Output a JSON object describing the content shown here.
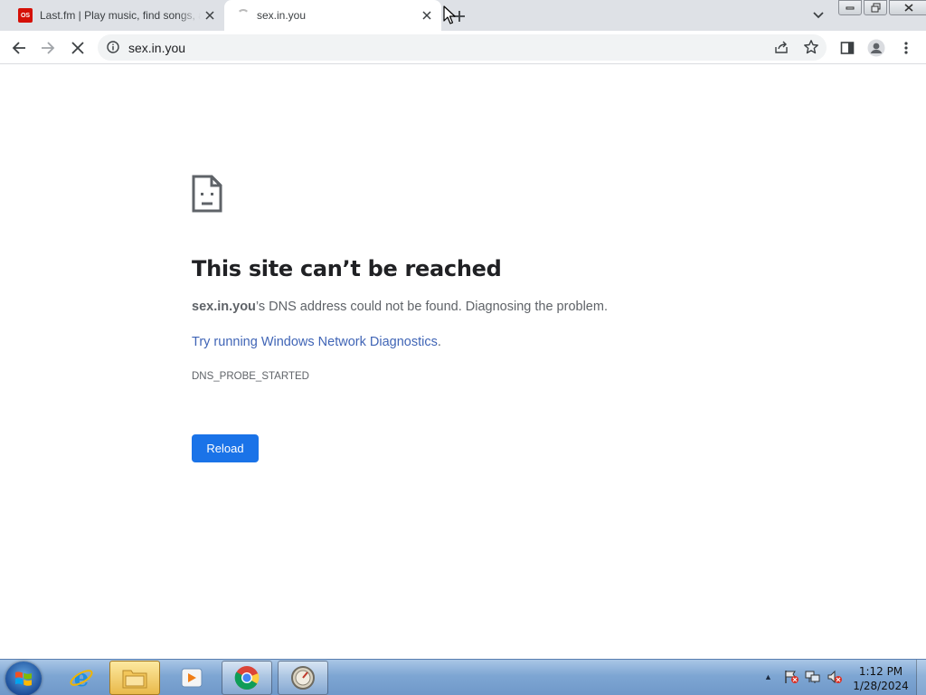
{
  "browser": {
    "tabs": [
      {
        "title": "Last.fm | Play music, find songs, and discover artists",
        "favicon": "lastfm-icon",
        "favicon_text": "OS",
        "active": false
      },
      {
        "title": "sex.in.you",
        "favicon": "loading-spinner",
        "active": true
      }
    ],
    "address_bar": {
      "url": "sex.in.you"
    }
  },
  "error_page": {
    "title": "This site can’t be reached",
    "host": "sex.in.you",
    "description_suffix": "’s DNS address could not be found. Diagnosing the problem.",
    "link_text": "Try running Windows Network Diagnostics",
    "link_suffix": ".",
    "error_code": "DNS_PROBE_STARTED",
    "reload_label": "Reload"
  },
  "taskbar": {
    "apps": [
      "internet-explorer",
      "file-explorer",
      "media-player",
      "chrome",
      "unknown-app"
    ],
    "clock": {
      "time": "1:12 PM",
      "date": "1/28/2024"
    }
  },
  "colors": {
    "accent": "#1a73e8",
    "link": "#4065b6",
    "lastfm": "#d51007"
  }
}
